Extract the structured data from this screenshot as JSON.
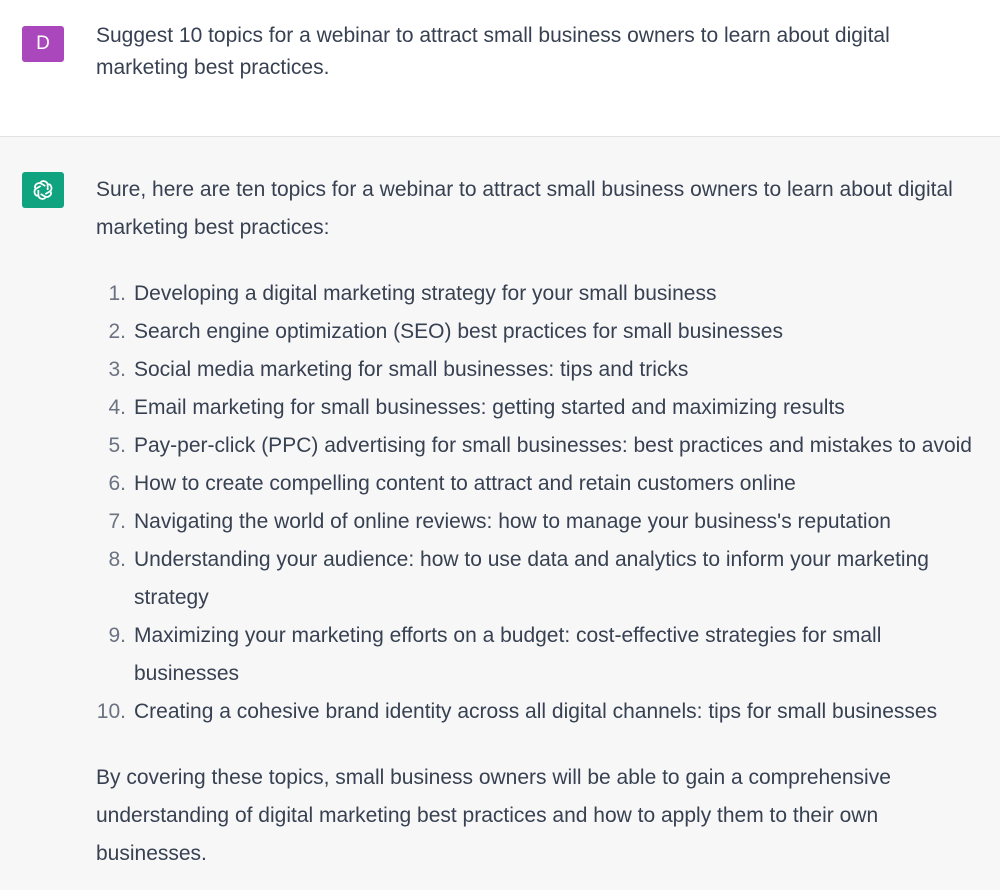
{
  "user_message": {
    "avatar_letter": "D",
    "avatar_color": "#ab47bc",
    "text": "Suggest 10 topics for a webinar to attract small business owners to learn about digital marketing best practices."
  },
  "assistant_message": {
    "avatar_icon": "openai-logo-icon",
    "avatar_color": "#10a37f",
    "intro": "Sure, here are ten topics for a webinar to attract small business owners to learn about digital marketing best practices:",
    "topics": [
      {
        "num": "1.",
        "text": "Developing a digital marketing strategy for your small business"
      },
      {
        "num": "2.",
        "text": "Search engine optimization (SEO) best practices for small businesses"
      },
      {
        "num": "3.",
        "text": "Social media marketing for small businesses: tips and tricks"
      },
      {
        "num": "4.",
        "text": "Email marketing for small businesses: getting started and maximizing results"
      },
      {
        "num": "5.",
        "text": "Pay-per-click (PPC) advertising for small businesses: best practices and mistakes to avoid"
      },
      {
        "num": "6.",
        "text": "How to create compelling content to attract and retain customers online"
      },
      {
        "num": "7.",
        "text": "Navigating the world of online reviews: how to manage your business's reputation"
      },
      {
        "num": "8.",
        "text": "Understanding your audience: how to use data and analytics to inform your marketing strategy"
      },
      {
        "num": "9.",
        "text": "Maximizing your marketing efforts on a budget: cost-effective strategies for small businesses"
      },
      {
        "num": "10.",
        "text": "Creating a cohesive brand identity across all digital channels: tips for small businesses"
      }
    ],
    "conclusion": "By covering these topics, small business owners will be able to gain a comprehensive understanding of digital marketing best practices and how to apply them to their own businesses."
  }
}
